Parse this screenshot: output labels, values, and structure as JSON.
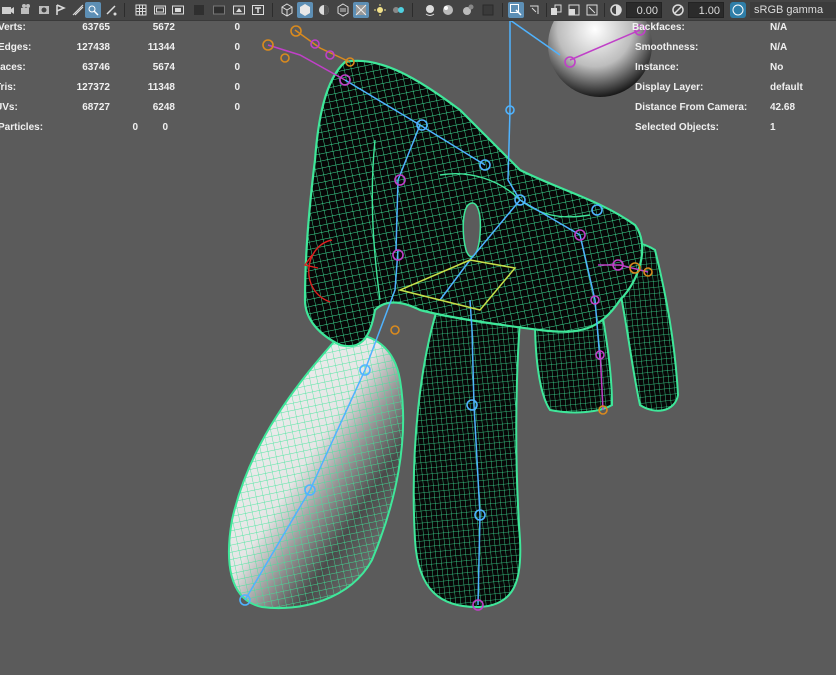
{
  "toolbar": {
    "exposure_value": "0.00",
    "gamma_value": "1.00",
    "colorspace_label": "sRGB gamma",
    "icons": [
      "camera-select-icon",
      "camera-attributes-icon",
      "bookmarks-icon",
      "image-plane-icon",
      "grid-icon",
      "film-gate-icon",
      "resolution-gate-icon",
      "gate-mask-icon",
      "field-chart-icon",
      "safe-action-icon",
      "safe-title-icon",
      "wireframe-icon",
      "smooth-shade-icon",
      "wireframe-on-shaded-icon",
      "textured-icon",
      "use-all-lights-icon",
      "shadows-icon",
      "screen-space-ao-icon",
      "motion-blur-icon",
      "anti-aliasing-icon",
      "depth-of-field-icon",
      "isolate-select-icon",
      "xray-icon",
      "xray-joints-icon",
      "xray-components-icon",
      "exposure-icon",
      "gamma-icon",
      "color-management-icon"
    ]
  },
  "hud_left": {
    "rows": [
      {
        "label": "Verts:",
        "total": "63765",
        "selected": "5672",
        "components": "0"
      },
      {
        "label": "Edges:",
        "total": "127438",
        "selected": "11344",
        "components": "0"
      },
      {
        "label": "Faces:",
        "total": "63746",
        "selected": "5674",
        "components": "0"
      },
      {
        "label": "Tris:",
        "total": "127372",
        "selected": "11348",
        "components": "0"
      },
      {
        "label": "UVs:",
        "total": "68727",
        "selected": "6248",
        "components": "0"
      }
    ],
    "particles": {
      "label": "Particles:",
      "total": "0",
      "selected": "0"
    }
  },
  "hud_right": {
    "rows": [
      {
        "label": "Backfaces:",
        "value": "N/A"
      },
      {
        "label": "Smoothness:",
        "value": "N/A"
      },
      {
        "label": "Instance:",
        "value": "No"
      },
      {
        "label": "Display Layer:",
        "value": "default"
      },
      {
        "label": "Distance From Camera:",
        "value": "42.68"
      },
      {
        "label": "Selected Objects:",
        "value": "1"
      }
    ]
  },
  "colors": {
    "viewport_bg": "#5b5b5b",
    "wire_selected": "#3fe79a",
    "joint_blue": "#4fb3ff",
    "joint_magenta": "#c040c8",
    "joint_orange": "#d98a1e",
    "active_button": "#5d8fb5"
  }
}
